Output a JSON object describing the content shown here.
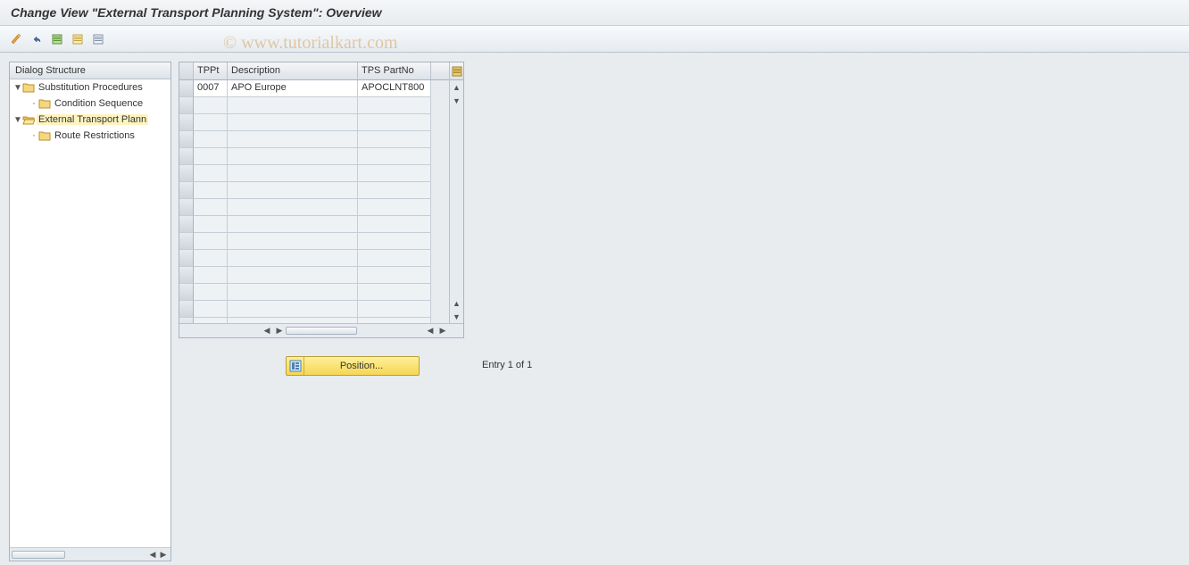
{
  "title": "Change View \"External Transport Planning System\": Overview",
  "watermark": "© www.tutorialkart.com",
  "sidebar": {
    "header": "Dialog Structure",
    "items": [
      {
        "label": "Substitution Procedures",
        "level": 1,
        "expanded": true,
        "selected": false,
        "folder_open": false
      },
      {
        "label": "Condition Sequence",
        "level": 2,
        "expanded": false,
        "selected": false,
        "folder_open": false
      },
      {
        "label": "External Transport Plann",
        "level": 1,
        "expanded": true,
        "selected": true,
        "folder_open": true
      },
      {
        "label": "Route Restrictions",
        "level": 2,
        "expanded": false,
        "selected": false,
        "folder_open": false
      }
    ]
  },
  "table": {
    "columns": {
      "c1": "TPPt",
      "c2": "Description",
      "c3": "TPS PartNo"
    },
    "rows": [
      {
        "c1": "0007",
        "c2": "APO Europe",
        "c3": "APOCLNT800"
      }
    ],
    "empty_rows": 14
  },
  "position_button": "Position...",
  "entry_status": "Entry 1 of 1"
}
